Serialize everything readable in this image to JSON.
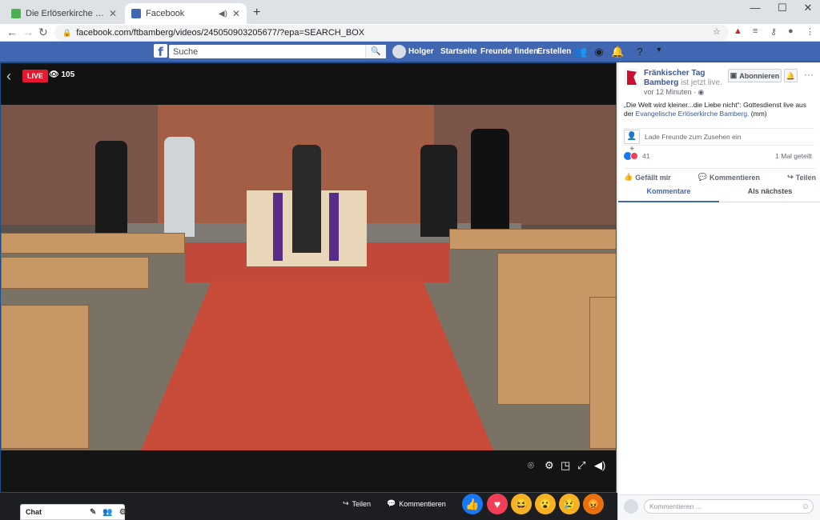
{
  "browser": {
    "tabs": [
      {
        "title": "Die Erlöserkirche in Bamberg ist",
        "fav_color": "#4caf50"
      },
      {
        "title": "Facebook",
        "fav_color": "#4267b2"
      }
    ],
    "url": "facebook.com/ftbamberg/videos/245050903205677/?epa=SEARCH_BOX"
  },
  "fb_header": {
    "logo": "f",
    "search_placeholder": "Suche",
    "user_name": "Holger",
    "nav": [
      "Startseite",
      "Freunde finden",
      "Erstellen"
    ]
  },
  "video": {
    "live_label": "LIVE",
    "viewer_count": "105"
  },
  "post": {
    "page_name": "Fränkischer Tag Bamberg",
    "status": "ist jetzt live.",
    "time": "vor 12 Minuten",
    "subscribe_label": "Abonnieren",
    "description_text": "„Die Welt wird kleiner...die Liebe nicht“: Gottesdienst live aus der",
    "description_link": "Evangelische Erlöserkirche Bamberg.",
    "description_tail": "(mm)",
    "invite_text": "Lade Freunde zum Zusehen ein",
    "reaction_count": "41",
    "share_count": "1 Mal geteilt",
    "actions": [
      "Gefällt mir",
      "Kommentieren",
      "Teilen"
    ],
    "comment_tabs": [
      "Kommentare",
      "Als nächstes"
    ],
    "comment_placeholder": "Kommentieren ..."
  },
  "bottom": {
    "chat_label": "Chat",
    "share_label": "Teilen",
    "comment_label": "Kommentieren"
  },
  "icons": {
    "reactions": [
      "like",
      "love",
      "haha",
      "wow",
      "sad",
      "angry"
    ]
  }
}
